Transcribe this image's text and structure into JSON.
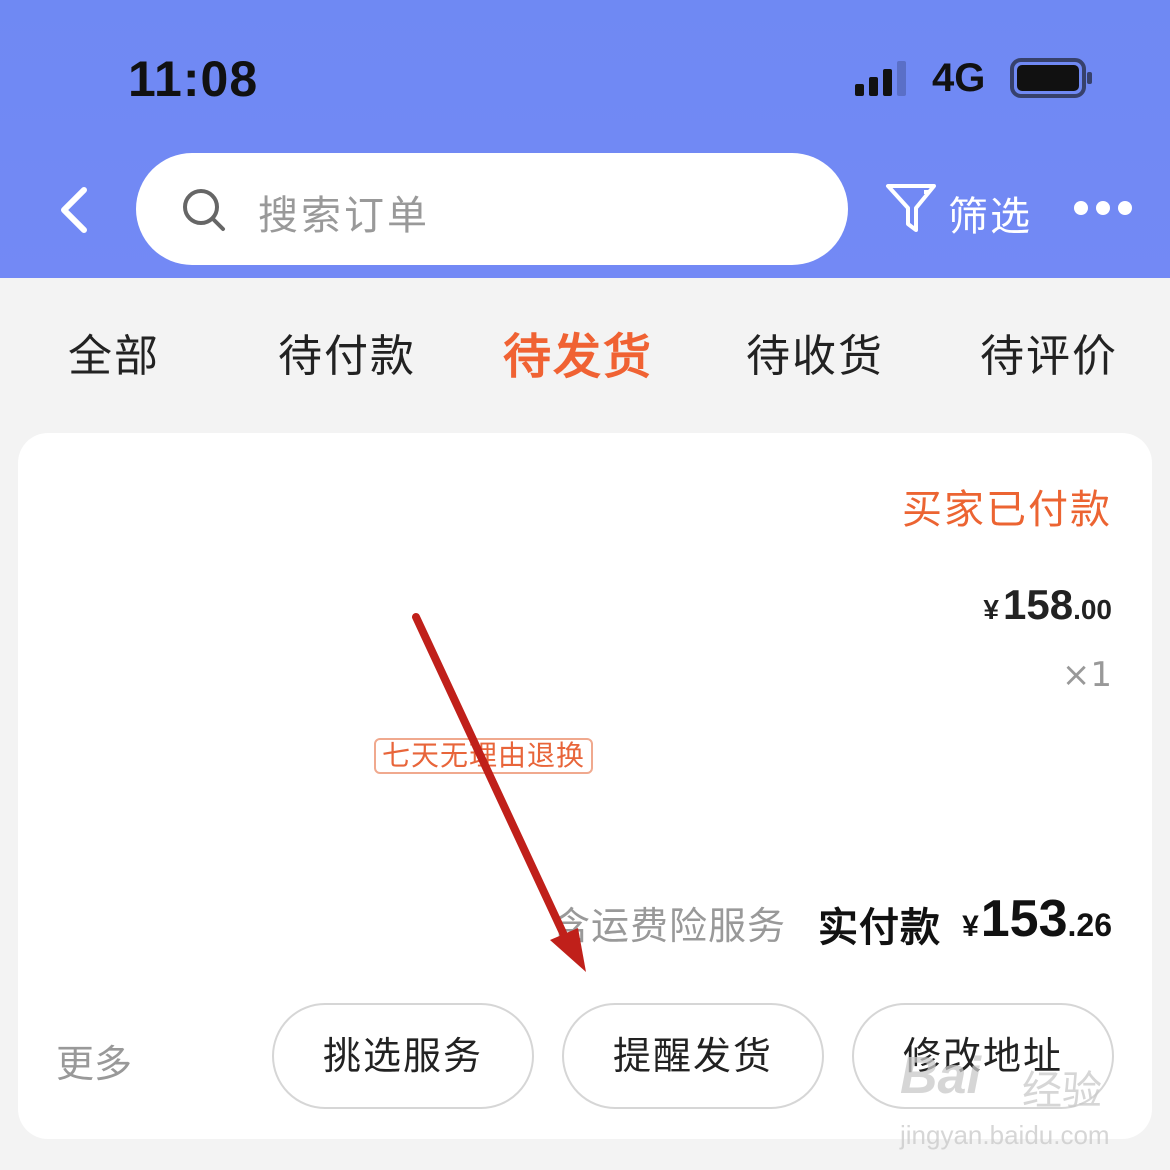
{
  "status_bar": {
    "time": "11:08",
    "network": "4G",
    "signal_icon": "signal-bars-icon",
    "battery_icon": "battery-full-icon"
  },
  "header": {
    "back_icon": "chevron-left-icon",
    "search": {
      "placeholder": "搜索订单",
      "icon": "search-icon"
    },
    "filter": {
      "label": "筛选",
      "icon": "funnel-icon"
    },
    "more_icon": "more-dots-icon",
    "background": "#7089f4"
  },
  "tabs": [
    {
      "label": "全部"
    },
    {
      "label": "待付款"
    },
    {
      "label": "待发货",
      "active": true
    },
    {
      "label": "待收货"
    },
    {
      "label": "待评价"
    }
  ],
  "accent_color": "#f06233",
  "order": {
    "status": "买家已付款",
    "unit_price": {
      "symbol": "¥",
      "integer": "158",
      "decimal": ".00"
    },
    "quantity": "×1",
    "tag": "七天无理由退换",
    "insurance": "含运费险服务",
    "paid_label": "实付款",
    "paid_amount": {
      "symbol": "¥",
      "integer": "153",
      "decimal": ".26"
    },
    "more_link": "更多",
    "actions": [
      "挑选服务",
      "提醒发货",
      "修改地址"
    ]
  },
  "annotation": {
    "arrow_color": "#c0201a",
    "arrow_icon": "red-arrow-annotation"
  },
  "watermark": {
    "brand": "Bai",
    "brand_cn": "经验",
    "url": "jingyan.baidu.com"
  }
}
